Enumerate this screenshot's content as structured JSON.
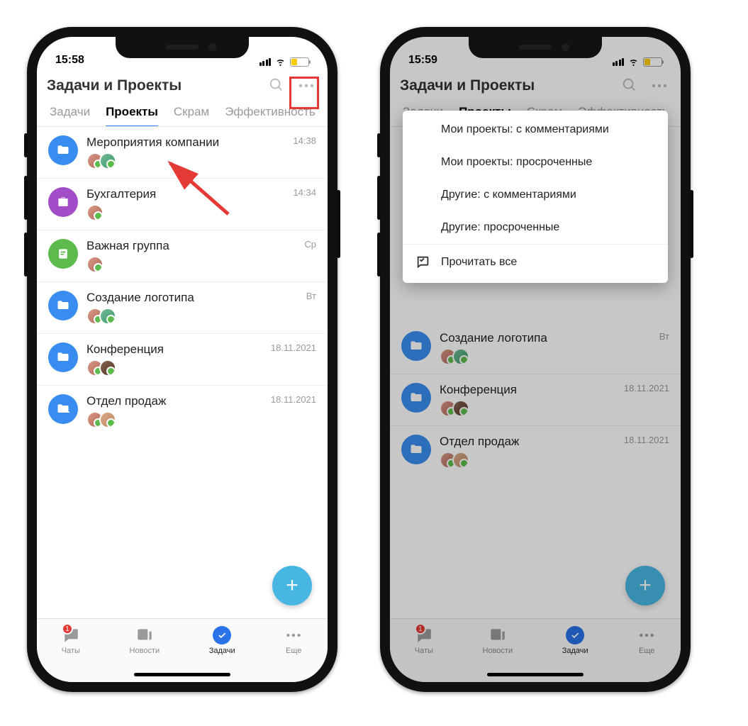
{
  "phones": [
    {
      "time": "15:58"
    },
    {
      "time": "15:59"
    }
  ],
  "header": {
    "title": "Задачи и Проекты"
  },
  "tabs": [
    "Задачи",
    "Проекты",
    "Скрам",
    "Эффективность"
  ],
  "active_tab_index": 1,
  "projects": [
    {
      "title": "Мероприятия компании",
      "time": "14:38",
      "icon": "folder",
      "color": "blue",
      "avatars": [
        "a1",
        "a2"
      ]
    },
    {
      "title": "Бухгалтерия",
      "time": "14:34",
      "icon": "briefcase",
      "color": "purple",
      "avatars": [
        "a1"
      ]
    },
    {
      "title": "Важная группа",
      "time": "Ср",
      "icon": "note",
      "color": "green",
      "avatars": [
        "a1"
      ]
    },
    {
      "title": "Создание логотипа",
      "time": "Вт",
      "icon": "folder",
      "color": "blue",
      "avatars": [
        "a1",
        "a2"
      ]
    },
    {
      "title": "Конференция",
      "time": "18.11.2021",
      "icon": "folder",
      "color": "blue",
      "avatars": [
        "a1",
        "a3"
      ]
    },
    {
      "title": "Отдел продаж",
      "time": "18.11.2021",
      "icon": "folder",
      "color": "blue",
      "avatars": [
        "a1",
        "a4"
      ]
    }
  ],
  "bottom_nav": [
    {
      "label": "Чаты",
      "icon": "chat",
      "badge": "1"
    },
    {
      "label": "Новости",
      "icon": "news"
    },
    {
      "label": "Задачи",
      "icon": "check",
      "active": true
    },
    {
      "label": "Еще",
      "icon": "more"
    }
  ],
  "popup_menu": {
    "items": [
      "Мои проекты: с комментариями",
      "Мои проекты: просроченные",
      "Другие: с комментариями",
      "Другие: просроченные"
    ],
    "read_all": "Прочитать все"
  },
  "phone2_visible_projects_start": 3
}
